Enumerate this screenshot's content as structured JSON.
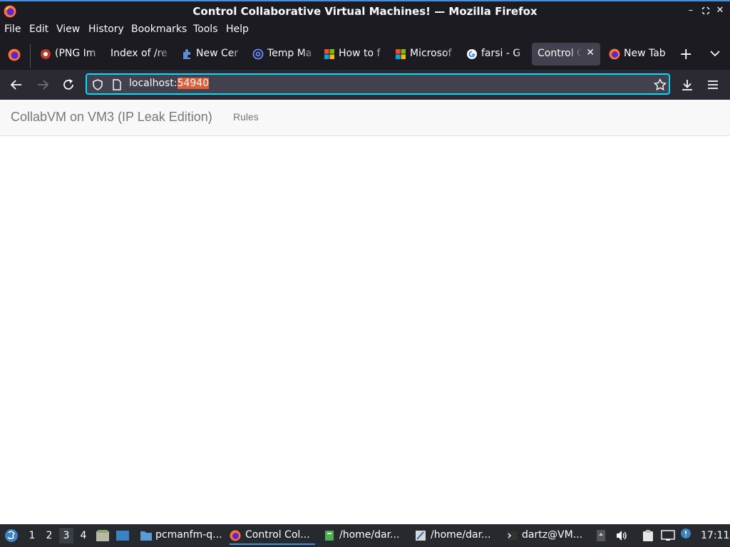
{
  "window": {
    "title": "Control Collaborative Virtual Machines! — Mozilla Firefox",
    "controls": [
      "minimize",
      "maximize",
      "close"
    ]
  },
  "menubar": {
    "items": [
      "File",
      "Edit",
      "View",
      "History",
      "Bookmarks",
      "Tools",
      "Help"
    ]
  },
  "tabs": [
    {
      "label": "(PNG Im",
      "icon": "red-circle-icon"
    },
    {
      "label": "Index of /re",
      "icon": ""
    },
    {
      "label": "New Cer",
      "icon": "puzzle-icon"
    },
    {
      "label": "Temp Ma",
      "icon": "at-sign-icon"
    },
    {
      "label": "How to f",
      "icon": "microsoft-icon"
    },
    {
      "label": "Microsof",
      "icon": "microsoft-icon"
    },
    {
      "label": "farsi - G",
      "icon": "google-icon"
    },
    {
      "label": "Control C",
      "icon": "",
      "active": true
    },
    {
      "label": "New Tab",
      "icon": "firefox-icon"
    }
  ],
  "navbar": {
    "url_host": "localhost:",
    "url_port": "54940"
  },
  "page": {
    "brand": "CollabVM on VM3 (IP Leak Edition)",
    "nav_link": "Rules"
  },
  "taskbar": {
    "workspaces": [
      "1",
      "2",
      "3",
      "4"
    ],
    "active_workspace": "3",
    "tasks": [
      {
        "label": "pcmanfm-q...",
        "icon": "folder-icon"
      },
      {
        "label": "Control Col...",
        "icon": "firefox-icon",
        "active": true
      },
      {
        "label": "/home/dar...",
        "icon": "editor-icon"
      },
      {
        "label": "/home/dar...",
        "icon": "pen-icon"
      },
      {
        "label": "dartz@VM...",
        "icon": "terminal-icon"
      }
    ],
    "clock": "17:11"
  },
  "colors": {
    "chrome_dark": "#1c1b22",
    "toolbar": "#2b2a33",
    "urlbar_focus": "#00ddff",
    "url_selection": "#e05d37",
    "taskbar": "#262a2f"
  }
}
